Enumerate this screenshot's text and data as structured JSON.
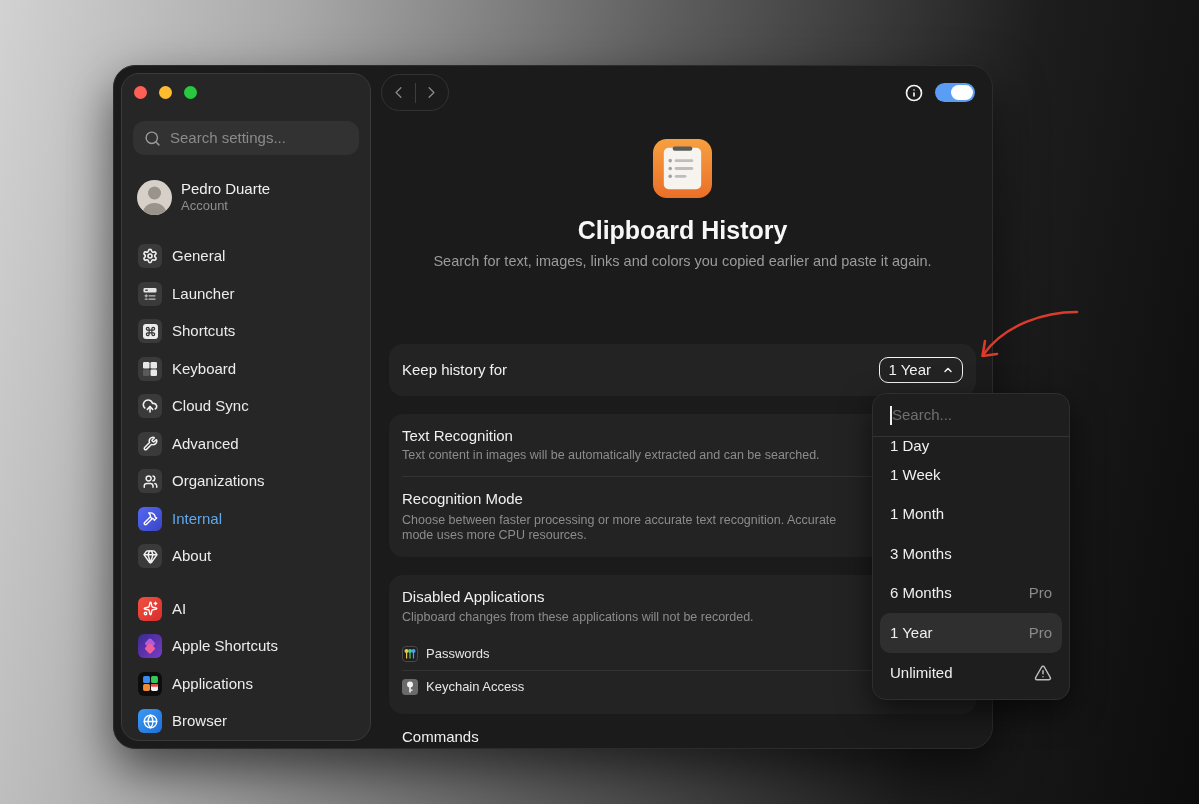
{
  "sidebar": {
    "search": {
      "placeholder": "Search settings..."
    },
    "account": {
      "name": "Pedro Duarte",
      "subtitle": "Account"
    },
    "groups": [
      {
        "items": [
          {
            "label": "General",
            "selected": false
          },
          {
            "label": "Launcher",
            "selected": false
          },
          {
            "label": "Shortcuts",
            "selected": false
          },
          {
            "label": "Keyboard",
            "selected": false
          },
          {
            "label": "Cloud Sync",
            "selected": false
          },
          {
            "label": "Advanced",
            "selected": false
          },
          {
            "label": "Organizations",
            "selected": false
          },
          {
            "label": "Internal",
            "selected": true
          },
          {
            "label": "About",
            "selected": false
          }
        ]
      },
      {
        "items": [
          {
            "label": "AI",
            "selected": false
          },
          {
            "label": "Apple Shortcuts",
            "selected": false
          },
          {
            "label": "Applications",
            "selected": false
          },
          {
            "label": "Browser",
            "selected": false
          }
        ]
      }
    ]
  },
  "toolbar": {
    "toggle": {
      "on": true
    }
  },
  "header": {
    "title": "Clipboard History",
    "subtitle": "Search for text, images, links and colors you copied earlier and paste it again."
  },
  "sections": [
    {
      "kind": "select",
      "label": "Keep history for",
      "value": "1 Year",
      "expanded": true
    },
    {
      "kind": "group",
      "rows": [
        {
          "title": "Text Recognition",
          "description": "Text content in images will be automatically extracted and can be searched."
        },
        {
          "title": "Recognition Mode",
          "description": "Choose between faster processing or more accurate text recognition. Accurate mode uses more CPU resources."
        }
      ]
    },
    {
      "kind": "apps",
      "title": "Disabled Applications",
      "description": "Clipboard changes from these applications will not be recorded.",
      "apps": [
        {
          "name": "Passwords"
        },
        {
          "name": "Keychain Access"
        }
      ]
    },
    {
      "kind": "heading",
      "title": "Commands"
    }
  ],
  "dropdown": {
    "search": {
      "placeholder": "Search..."
    },
    "options": [
      {
        "label": "1 Day",
        "selected": false,
        "warning": false
      },
      {
        "label": "1 Week",
        "selected": false,
        "warning": false
      },
      {
        "label": "1 Month",
        "selected": false,
        "warning": false
      },
      {
        "label": "3 Months",
        "selected": false,
        "warning": false
      },
      {
        "label": "6 Months",
        "tag": "Pro",
        "selected": false,
        "warning": false
      },
      {
        "label": "1 Year",
        "tag": "Pro",
        "selected": true,
        "warning": false
      },
      {
        "label": "Unlimited",
        "selected": false,
        "warning": true
      }
    ]
  }
}
